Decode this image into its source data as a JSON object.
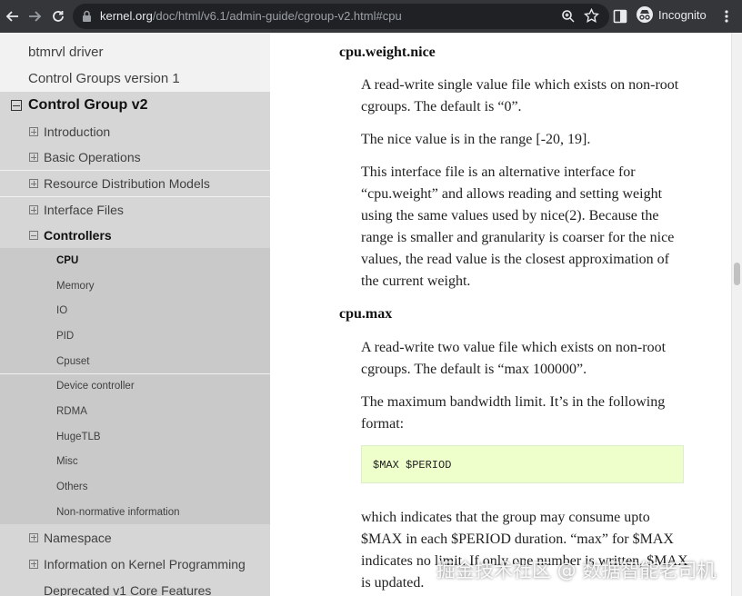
{
  "browser": {
    "url_host": "kernel.org",
    "url_path": "/doc/html/v6.1/admin-guide/cgroup-v2.html#cpu",
    "profile_label": "Incognito",
    "icons": [
      "back-arrow-icon",
      "forward-arrow-icon",
      "reload-icon",
      "lock-icon",
      "zoom-icon",
      "star-icon",
      "side-panel-icon",
      "incognito-icon",
      "more-vert-icon"
    ]
  },
  "sidebar": {
    "top_items": [
      {
        "label": "btmrvl driver"
      },
      {
        "label": "Control Groups version 1"
      }
    ],
    "expanded_section": {
      "label": "Control Group v2",
      "children_before": [
        {
          "label": "Introduction"
        },
        {
          "label": "Basic Operations"
        },
        {
          "label": "Resource Distribution Models"
        },
        {
          "label": "Interface Files"
        }
      ],
      "controllers": {
        "label": "Controllers",
        "items": [
          {
            "label": "CPU"
          },
          {
            "label": "Memory"
          },
          {
            "label": "IO"
          },
          {
            "label": "PID"
          },
          {
            "label": "Cpuset"
          },
          {
            "label": "Device controller"
          },
          {
            "label": "RDMA"
          },
          {
            "label": "HugeTLB"
          },
          {
            "label": "Misc"
          },
          {
            "label": "Others"
          },
          {
            "label": "Non-normative information"
          }
        ]
      },
      "children_after": [
        {
          "label": "Namespace"
        },
        {
          "label": "Information on Kernel Programming"
        },
        {
          "label": "Deprecated v1 Core Features"
        }
      ]
    }
  },
  "content": {
    "sections": [
      {
        "heading": "cpu.weight.nice",
        "paragraphs": [
          "A read-write single value file which exists on non-root cgroups. The default is “0”.",
          "The nice value is in the range [-20, 19].",
          "This interface file is an alternative interface for “cpu.weight” and allows reading and setting weight using the same values used by nice(2). Because the range is smaller and granularity is coarser for the nice values, the read value is the closest approximation of the current weight."
        ]
      },
      {
        "heading": "cpu.max",
        "paragraphs": [
          "A read-write two value file which exists on non-root cgroups. The default is “max 100000”.",
          "The maximum bandwidth limit. It’s in the following format:",
          "which indicates that the group may consume upto $MAX in each $PERIOD duration. “max” for $MAX indicates no limit. If only one number is written, $MAX is updated."
        ],
        "code": "$MAX $PERIOD"
      }
    ]
  },
  "watermark": "掘金技术社区 @ 数据智能老司机"
}
